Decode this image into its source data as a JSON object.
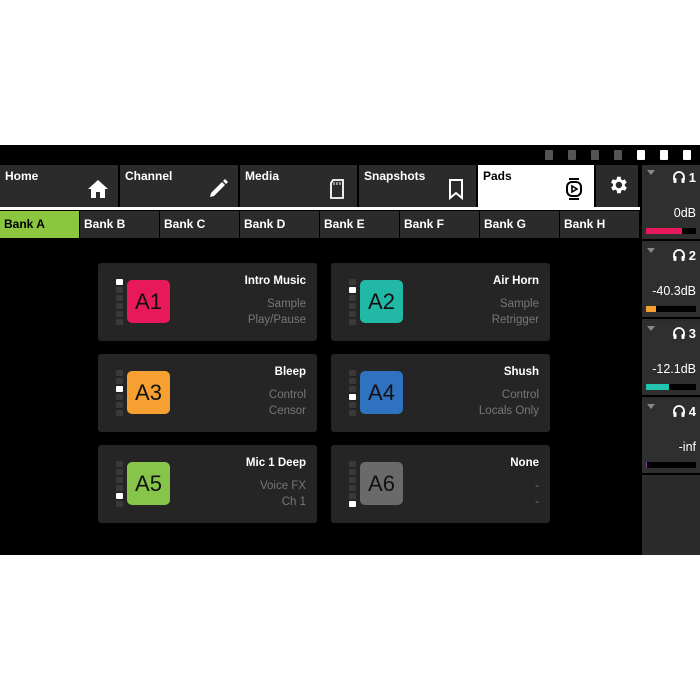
{
  "status_icons": [
    "disconnect-icon",
    "routing-icon",
    "speaker-icon",
    "music-down-icon",
    "sd-card-icon",
    "usb-icon",
    "bluetooth-icon"
  ],
  "nav": {
    "tabs": [
      {
        "label": "Home",
        "icon": "home-icon",
        "active": false
      },
      {
        "label": "Channel",
        "icon": "pencil-icon",
        "active": false
      },
      {
        "label": "Media",
        "icon": "sd-card-icon",
        "active": false
      },
      {
        "label": "Snapshots",
        "icon": "bookmark-icon",
        "active": false
      },
      {
        "label": "Pads",
        "icon": "pad-play-icon",
        "active": true
      }
    ],
    "settings_icon": "gear-icon"
  },
  "banks": [
    {
      "label": "Bank A",
      "active": true
    },
    {
      "label": "Bank B",
      "active": false
    },
    {
      "label": "Bank C",
      "active": false
    },
    {
      "label": "Bank D",
      "active": false
    },
    {
      "label": "Bank E",
      "active": false
    },
    {
      "label": "Bank F",
      "active": false
    },
    {
      "label": "Bank G",
      "active": false
    },
    {
      "label": "Bank H",
      "active": false
    }
  ],
  "pads": [
    {
      "key": "A1",
      "name": "Intro Music",
      "line1": "Sample",
      "line2": "Play/Pause",
      "color": "#e8195a",
      "led_active": 1
    },
    {
      "key": "A2",
      "name": "Air Horn",
      "line1": "Sample",
      "line2": "Retrigger",
      "color": "#22b8a6",
      "led_active": 2
    },
    {
      "key": "A3",
      "name": "Bleep",
      "line1": "Control",
      "line2": "Censor",
      "color": "#f5a030",
      "led_active": 3
    },
    {
      "key": "A4",
      "name": "Shush",
      "line1": "Control",
      "line2": "Locals Only",
      "color": "#2f72c0",
      "led_active": 4
    },
    {
      "key": "A5",
      "name": "Mic 1 Deep",
      "line1": "Voice FX",
      "line2": "Ch 1",
      "color": "#86c44a",
      "led_active": 5
    },
    {
      "key": "A6",
      "name": "None",
      "line1": "-",
      "line2": "-",
      "color": "#6a6a6a",
      "led_active": 6
    }
  ],
  "headphones": [
    {
      "num": "1",
      "level": "0dB",
      "meter_fraction": 0.72,
      "color": "#e8195a"
    },
    {
      "num": "2",
      "level": "-40.3dB",
      "meter_fraction": 0.2,
      "color": "#f5a030"
    },
    {
      "num": "3",
      "level": "-12.1dB",
      "meter_fraction": 0.45,
      "color": "#22c4b0"
    },
    {
      "num": "4",
      "level": "-inf",
      "meter_fraction": 0.02,
      "color": "#7a3aa0"
    }
  ]
}
